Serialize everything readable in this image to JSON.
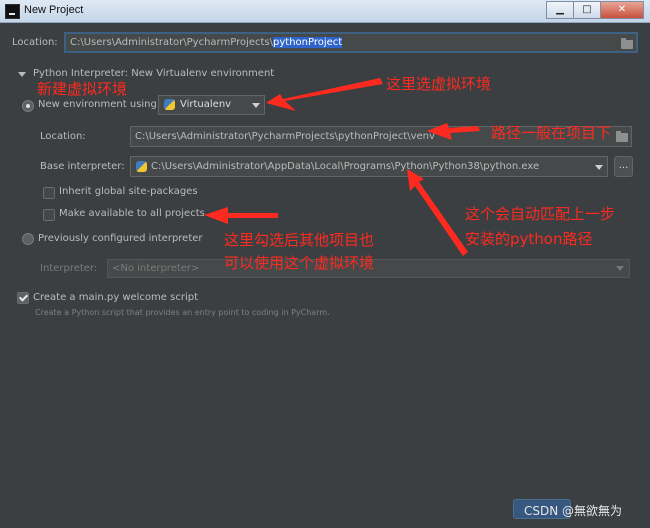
{
  "window": {
    "title": "New Project",
    "controls": {
      "minimize": "▁",
      "maximize": "□",
      "close": "✕"
    }
  },
  "project": {
    "location_label": "Location:",
    "location_prefix": "C:\\Users\\Administrator\\PycharmProjects\\",
    "location_selected": "pythonProject"
  },
  "interpreter": {
    "section_title": "Python Interpreter: New Virtualenv environment",
    "new_env_label": "New environment using",
    "env_tool": "Virtualenv",
    "env_location_label": "Location:",
    "env_location_value": "C:\\Users\\Administrator\\PycharmProjects\\pythonProject\\venv",
    "base_label": "Base interpreter:",
    "base_value": "C:\\Users\\Administrator\\AppData\\Local\\Programs\\Python\\Python38\\python.exe",
    "browse_label": "...",
    "inherit_label": "Inherit global site-packages",
    "make_available_label": "Make available to all projects",
    "previous_label": "Previously configured interpreter",
    "interp_label": "Interpreter:",
    "interp_value": "<No interpreter>"
  },
  "welcome": {
    "label": "Create a main.py welcome script",
    "description": "Create a Python script that provides an entry point to coding in PyCharm."
  },
  "annotations": {
    "new_env": "新建虚拟环境",
    "choose_env": "这里选虚拟环境",
    "path_hint": "路径一般在项目下",
    "auto_match_1": "这个会自动匹配上一步",
    "auto_match_2": "安装的python路径",
    "make_available_1": "这里勾选后其他项目也",
    "make_available_2": "可以使用这个虚拟环境"
  },
  "watermark": "CSDN @無欲無为",
  "colors": {
    "annotation": "#ff2a1f",
    "background": "#3c3f41",
    "selection": "#2f65ca"
  }
}
